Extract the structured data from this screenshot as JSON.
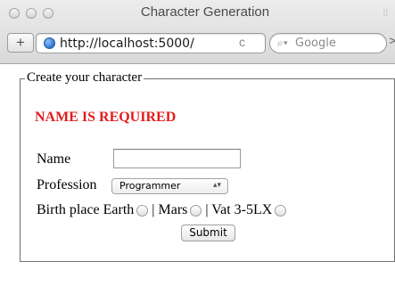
{
  "window": {
    "title": "Character Generation"
  },
  "toolbar": {
    "add_label": "+",
    "url": "http://localhost:5000/",
    "reload_label": "c",
    "search_placeholder": "Google"
  },
  "form": {
    "legend": "Create your character",
    "error": "NAME IS REQUIRED",
    "name_label": "Name",
    "name_value": "",
    "profession_label": "Profession",
    "profession_selected": "Programmer",
    "birth_label": "Birth place",
    "birth_options": [
      "Earth",
      "| Mars",
      "| Vat 3-5LX"
    ],
    "submit_label": "Submit"
  }
}
